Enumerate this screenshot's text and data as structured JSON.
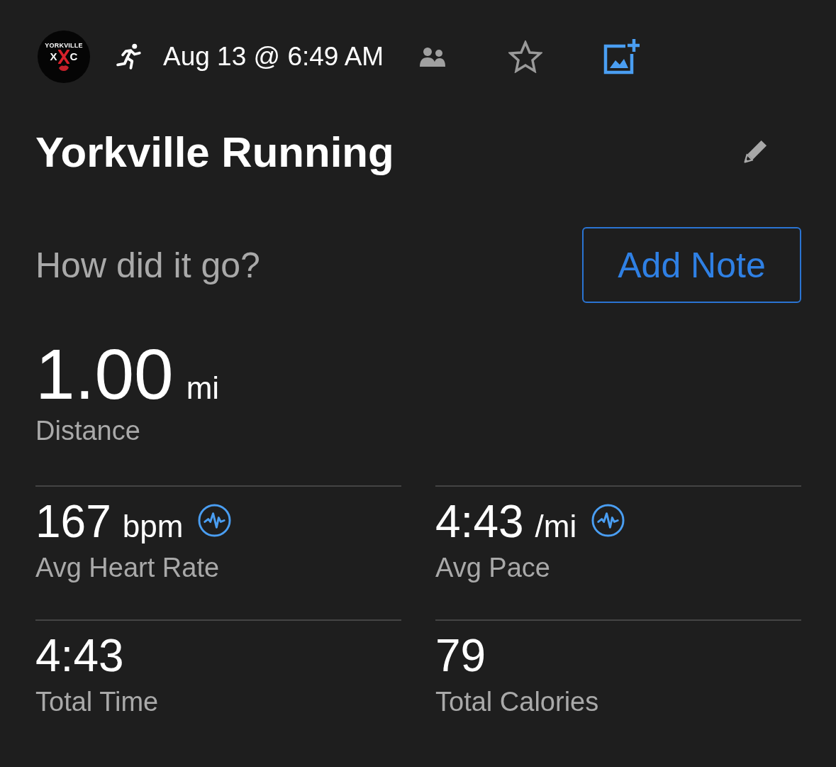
{
  "header": {
    "logo": {
      "top_text": "YORKVILLE",
      "letters": [
        "X",
        "C"
      ]
    },
    "date": "Aug 13 @ 6:49 AM",
    "favorite": false
  },
  "title": "Yorkville Running",
  "note": {
    "prompt": "How did it go?",
    "button": "Add Note"
  },
  "distance": {
    "value": "1.00",
    "unit": "mi",
    "label": "Distance"
  },
  "stats": [
    {
      "value": "167",
      "unit": "bpm",
      "label": "Avg Heart Rate",
      "has_chart": true
    },
    {
      "value": "4:43",
      "unit": "/mi",
      "label": "Avg Pace",
      "has_chart": true
    },
    {
      "value": "4:43",
      "label": "Total Time",
      "has_chart": false
    },
    {
      "value": "79",
      "label": "Total Calories",
      "has_chart": false
    }
  ]
}
